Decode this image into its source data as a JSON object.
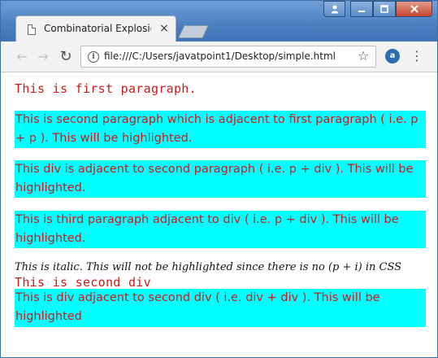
{
  "browser": {
    "tab_title": "Combinatorial Explosion",
    "tab_close": "×",
    "url": "file:///C:/Users/javatpoint1/Desktop/simple.html",
    "back_glyph": "←",
    "forward_glyph": "→",
    "reload_glyph": "↻",
    "star_glyph": "☆",
    "menu_glyph": "⋮",
    "icons": [
      "page-icon",
      "user-icon",
      "minimize-icon",
      "maximize-icon",
      "close-icon",
      "back-icon",
      "forward-icon",
      "reload-icon",
      "info-icon",
      "star-icon",
      "extension-icon",
      "menu-icon"
    ]
  },
  "page": {
    "p1": "This is first paragraph.",
    "p2": "This is second paragraph which is adjacent to first paragraph ( i.e. p + p ). This will be highlighted.",
    "div1": "This div is adjacent to second paragraph ( i.e. p + div ). This will be highlighted.",
    "p3": "This is third paragraph adjacent to div ( i.e. p + div ). This will be highlighted.",
    "italic": "This is italic. This will not be highlighted since there is no (p + i) in CSS",
    "div2": "This is second div",
    "div3": "This is div adjacent to second div ( i.e. div + div ). This will be highlighted"
  },
  "colors": {
    "text_red": "#c41c1c",
    "highlight_cyan": "#00ffff",
    "titlebar_blue": "#4a7fc0"
  }
}
